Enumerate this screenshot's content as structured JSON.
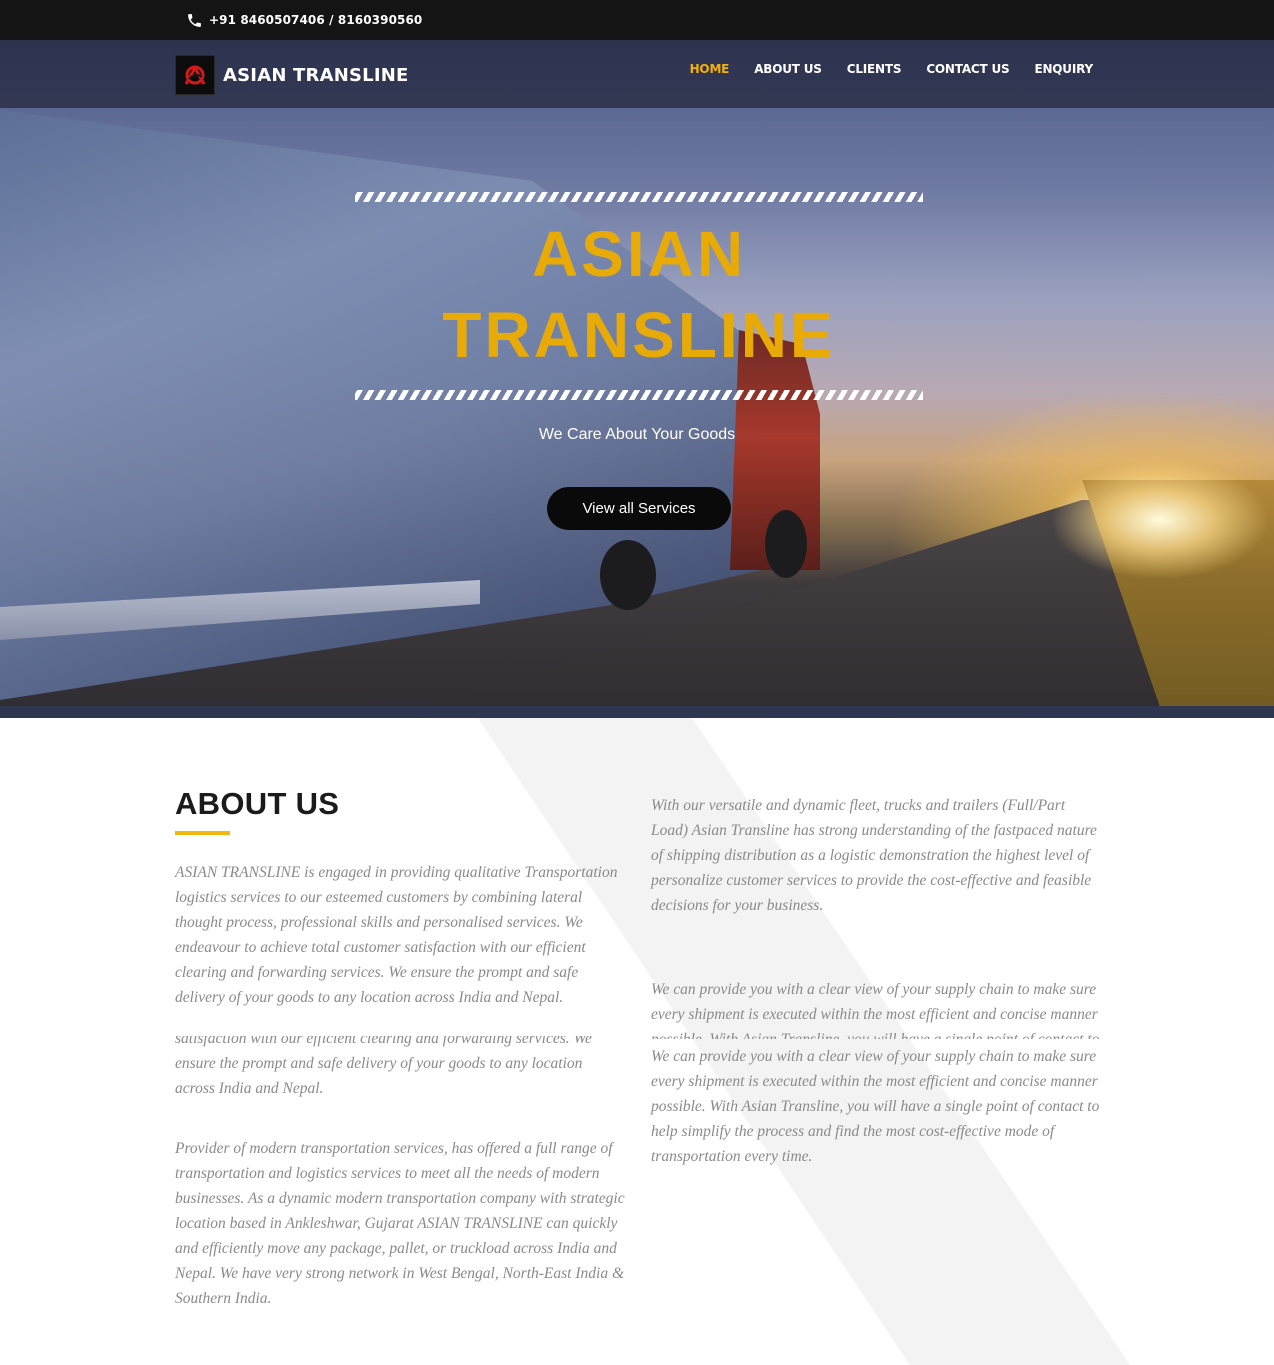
{
  "topbar": {
    "phone": "+91 8460507406 / 8160390560",
    "phone_icon": "phone-icon"
  },
  "header": {
    "brand": "ASIAN TRANSLINE",
    "nav": [
      "HOME",
      "ABOUT US",
      "CLIENTS",
      "CONTACT US",
      "ENQUIRY"
    ],
    "active": "HOME"
  },
  "hero": {
    "title_line1": "ASIAN",
    "title_line2": "TRANSLINE",
    "tagline": "We Care About Your Goods",
    "cta": "View all Services"
  },
  "about": {
    "title": "ABOUT US",
    "left_p1": "ASIAN TRANSLINE is engaged in providing qualitative Transportation logistics services to our esteemed customers by combining lateral thought process, professional skills and personalised services. We endeavour to achieve total customer satisfaction with our efficient clearing and forwarding services. We ensure the prompt and safe delivery of your goods to any location across India and Nepal.",
    "left_p1_dup": "satisfaction with our efficient clearing and forwarding services. We ensure the prompt and safe delivery of your goods to any location across India and Nepal.",
    "left_p2": "Provider of modern transportation services, has offered a full range of transportation and logistics services to meet all the needs of modern businesses. As a dynamic modern transportation company with strategic location based in Ankleshwar, Gujarat ASIAN TRANSLINE can quickly and efficiently move any package, pallet, or truckload across India and Nepal. We have very strong network in West Bengal, North-East India & Southern India.",
    "right_p1": "With our versatile and dynamic fleet, trucks and trailers (Full/Part Load) Asian Transline has strong understanding of the fastpaced nature of shipping distribution as a logistic demonstration the highest level of personalize customer services to provide the cost-effective and feasible decisions for your business.",
    "right_p2": "We can provide you with a clear view of your supply chain to make sure every shipment is executed within the most efficient and concise manner possible. With Asian Transline, you will have a single point of contact to help simplify the process and find the most cost-effective mode of transportation every time.",
    "colors": {
      "accent": "#f1b10e",
      "title_yellow": "#e8aa07",
      "text_gray": "#8a8a8a"
    }
  }
}
